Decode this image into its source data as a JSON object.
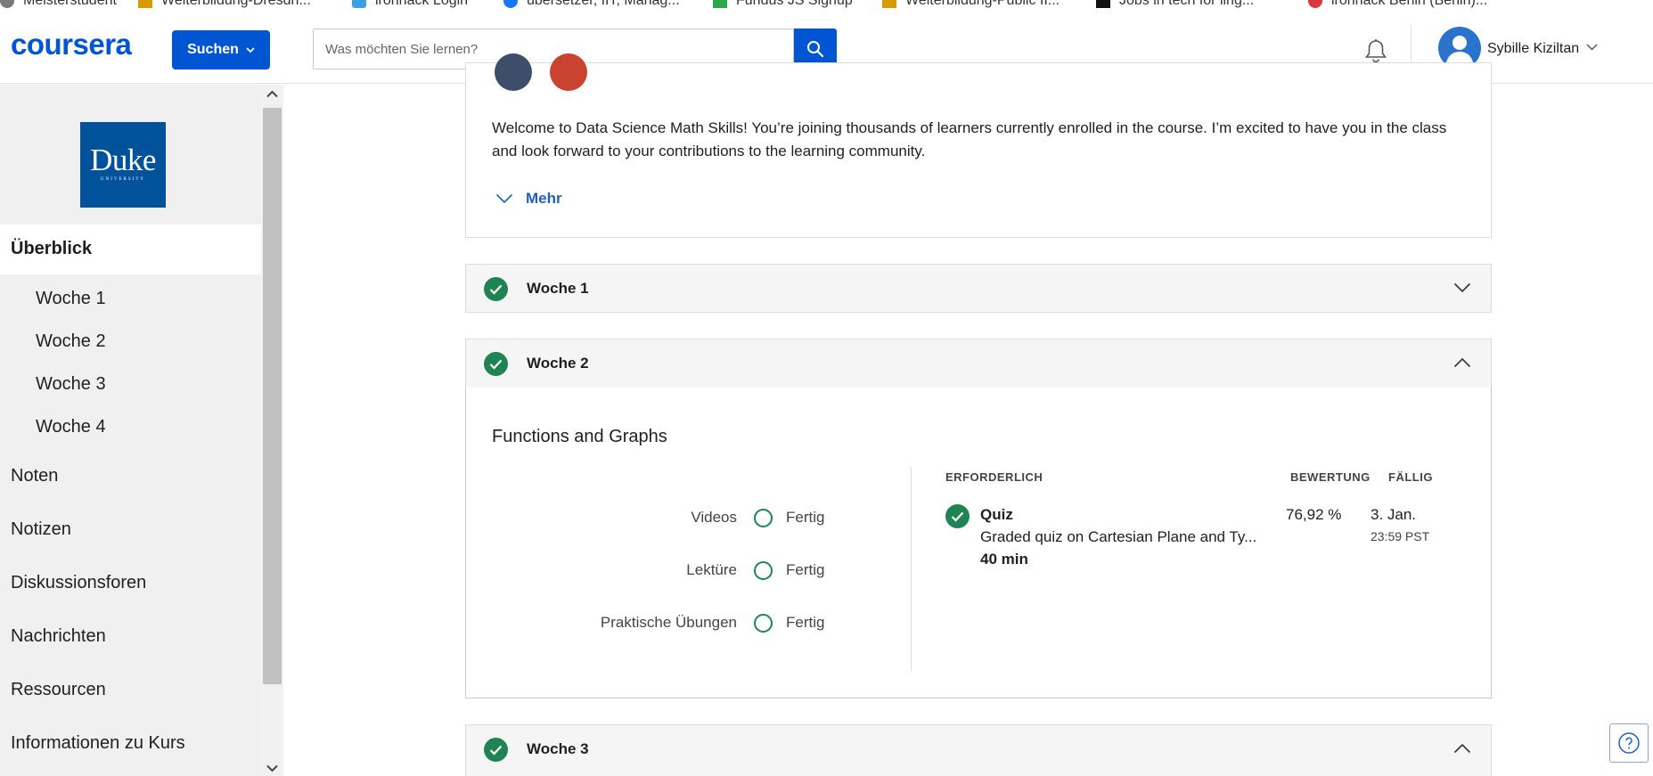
{
  "bookmarks": [
    {
      "label": "Meisterstudent",
      "color": "#7a7a7a"
    },
    {
      "label": "Weiterbildung-Dresdn...",
      "color": "#d89a00"
    },
    {
      "label": "ironhack Login",
      "color": "#3aa0e6"
    },
    {
      "label": "übersetzer, IIT, Manag...",
      "color": "#1877f2"
    },
    {
      "label": "Fundus JS Signup",
      "color": "#2aa84a"
    },
    {
      "label": "Weiterbildung-Public II...",
      "color": "#d89a00"
    },
    {
      "label": "Jobs in tech for ling...",
      "color": "#111111"
    },
    {
      "label": "ironhack Berlin (Berlin)...",
      "color": "#d9363e"
    }
  ],
  "header": {
    "logo": "coursera",
    "search_button": "Suchen",
    "search_placeholder": "Was möchten Sie lernen?",
    "icons": {
      "search": "search-icon",
      "bell": "bell-icon",
      "avatar": "user-avatar-icon",
      "chevron": "chevron-down-icon"
    },
    "user_name": "Sybille Kiziltan"
  },
  "sidebar": {
    "logo_text": "Duke",
    "logo_subtext": "UNIVERSITY",
    "active_item": "Überblick",
    "weeks": [
      "Woche 1",
      "Woche 2",
      "Woche 3",
      "Woche 4"
    ],
    "items": [
      "Noten",
      "Notizen",
      "Diskussionsforen",
      "Nachrichten",
      "Ressourcen",
      "Informationen zu Kurs"
    ]
  },
  "main": {
    "welcome_text": "Welcome to Data Science Math Skills! You’re joining thousands of learners currently enrolled in the course. I’m excited to have you in the class and look forward to your contributions to the learning community.",
    "more_label": "Mehr",
    "weeks": [
      {
        "label": "Woche 1",
        "completed": true,
        "expanded": false
      },
      {
        "label": "Woche 2",
        "completed": true,
        "expanded": true
      },
      {
        "label": "Woche 3",
        "completed": true,
        "expanded": true
      }
    ],
    "week2": {
      "title": "Functions and Graphs",
      "progress": [
        {
          "label": "Videos",
          "status": "Fertig"
        },
        {
          "label": "Lektüre",
          "status": "Fertig"
        },
        {
          "label": "Praktische Übungen",
          "status": "Fertig"
        }
      ],
      "columns": {
        "required": "ERFORDERLICH",
        "grade": "BEWERTUNG",
        "due": "FÄLLIG"
      },
      "quiz": {
        "type": "Quiz",
        "description": "Graded quiz on Cartesian Plane and Ty...",
        "duration": "40 min",
        "grade": "76,92 %",
        "due_date": "3. Jan.",
        "due_time": "23:59 PST"
      }
    }
  },
  "help_icon": "help-icon",
  "colors": {
    "brand": "#0056d2",
    "success": "#1f8354",
    "link": "#1e63b8",
    "sidebar_bg": "#f0f0f0"
  }
}
